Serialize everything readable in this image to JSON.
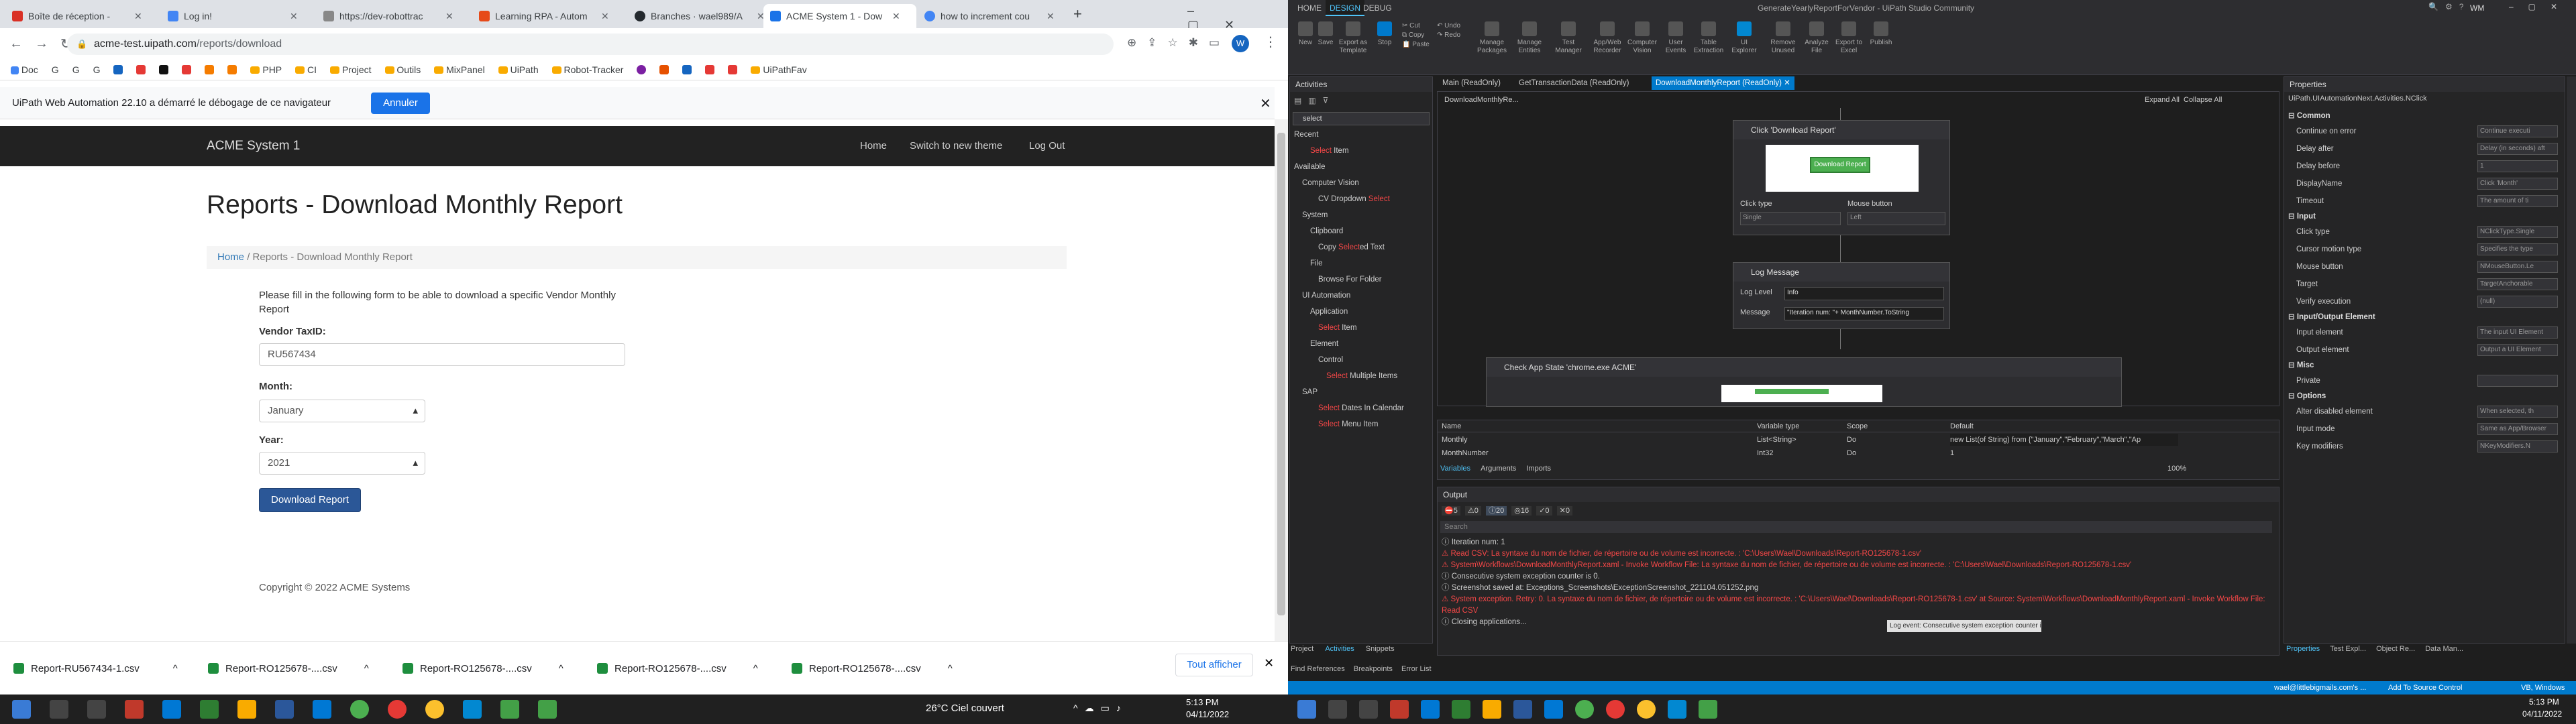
{
  "colors": {
    "accent_blue": "#1a73e8",
    "uipath_status": "#007acc",
    "error_red": "#f44747",
    "site_nav": "#222222",
    "button_blue": "#337ab7"
  },
  "browser": {
    "tabs": [
      {
        "title": "Boîte de réception - "
      },
      {
        "title": "Log in!"
      },
      {
        "title": "https://dev-robottrac"
      },
      {
        "title": "Learning RPA - Autom"
      },
      {
        "title": "Branches · wael989/A"
      },
      {
        "title": "ACME System 1 - Dow"
      },
      {
        "title": "how to increment cou"
      }
    ],
    "url_host": "acme-test.uipath.com",
    "url_path": "/reports/download",
    "bookmarks": [
      "Doc",
      "G",
      "G",
      "G",
      "PHP",
      "CI",
      "Project",
      "Outils",
      "MixPanel",
      "UiPath",
      "Robot-Tracker",
      "UiPathFav"
    ],
    "infobar": {
      "message": "UiPath Web Automation 22.10 a démarré le débogage de ce navigateur",
      "button": "Annuler"
    }
  },
  "site": {
    "brand": "ACME System 1",
    "nav": [
      "Home",
      "Switch to new theme",
      "Log Out"
    ],
    "title": "Reports - Download Monthly Report",
    "breadcrumb": {
      "home": "Home",
      "sep": "/",
      "current": "Reports - Download Monthly Report"
    },
    "intro": "Please fill in the following form to be able to download a specific Vendor Monthly Report",
    "vendor_label": "Vendor TaxID:",
    "vendor_value": "RU567434",
    "month_label": "Month:",
    "month_value": "January",
    "year_label": "Year:",
    "year_value": "2021",
    "button": "Download Report",
    "footer": "Copyright © 2022 ACME Systems"
  },
  "downloads": {
    "items": [
      "Report-RU567434-1.csv",
      "Report-RO125678-....csv",
      "Report-RO125678-....csv",
      "Report-RO125678-....csv",
      "Report-RO125678-....csv"
    ],
    "show_all": "Tout afficher"
  },
  "taskbar": {
    "weather": "26°C  Ciel couvert",
    "time": "5:13 PM",
    "date": "04/11/2022"
  },
  "studio": {
    "title": "GenerateYearlyReportForVendor - UiPath Studio Community",
    "user": "WM",
    "ribbon_tabs": [
      "HOME",
      "DESIGN",
      "DEBUG"
    ],
    "ribbon_buttons": [
      "New",
      "Save",
      "Export as Template",
      "Stop",
      "Cut",
      "Copy",
      "Paste",
      "Undo",
      "Redo",
      "Manage Packages",
      "Manage Entities",
      "Test Manager",
      "App/Web Recorder",
      "Computer Vision",
      "User Events",
      "Table Extraction",
      "UI Explorer",
      "Remove Unused",
      "Analyze File",
      "Export to Excel",
      "Publish"
    ],
    "activities": {
      "header": "Activities",
      "search": "select",
      "tree": [
        {
          "t": "Recent",
          "d": 0
        },
        {
          "t": "Select Item",
          "d": 2,
          "red": "Select"
        },
        {
          "t": "Available",
          "d": 0
        },
        {
          "t": "Computer Vision",
          "d": 1
        },
        {
          "t": "CV Dropdown Select",
          "d": 3
        },
        {
          "t": "System",
          "d": 1
        },
        {
          "t": "Clipboard",
          "d": 2
        },
        {
          "t": "Copy Selected Text",
          "d": 3
        },
        {
          "t": "File",
          "d": 2
        },
        {
          "t": "Browse For Folder",
          "d": 3
        },
        {
          "t": "UI Automation",
          "d": 1
        },
        {
          "t": "Application",
          "d": 2
        },
        {
          "t": "Select Item",
          "d": 3
        },
        {
          "t": "Element",
          "d": 2
        },
        {
          "t": "Control",
          "d": 3
        },
        {
          "t": "Select Multiple Items",
          "d": 4
        },
        {
          "t": "SAP",
          "d": 1
        },
        {
          "t": "Select Dates In Calendar",
          "d": 3
        },
        {
          "t": "Select Menu Item",
          "d": 3
        }
      ],
      "footer_tabs": [
        "Project",
        "Activities",
        "Snippets"
      ],
      "footer_tabs2": [
        "Find References",
        "Breakpoints",
        "Error List"
      ]
    },
    "doc_tabs": [
      "Main (ReadOnly)",
      "GetTransactionData (ReadOnly)",
      "DownloadMonthlyReport (ReadOnly)"
    ],
    "designer": {
      "crumb": "DownloadMonthlyRe...",
      "expand": "Expand All",
      "collapse": "Collapse All",
      "click_title": "Click 'Download Report'",
      "click_button": "Download Report",
      "click_type_label": "Click type",
      "click_type": "Single",
      "mouse_label": "Mouse button",
      "mouse": "Left",
      "log_title": "Log Message",
      "log_level_label": "Log Level",
      "log_level": "Info",
      "message_label": "Message",
      "message": "\"Iteration num: \"+ MonthNumber.ToString",
      "check_title": "Check App State 'chrome.exe ACME'"
    },
    "variables": {
      "headers": [
        "Name",
        "Variable type",
        "Scope",
        "Default"
      ],
      "rows": [
        [
          "Monthly",
          "List<String>",
          "Do",
          "new List(of String) from {\"January\",\"February\",\"March\",\"Ap"
        ],
        [
          "MonthNumber",
          "Int32",
          "Do",
          "1"
        ]
      ],
      "tabs": [
        "Variables",
        "Arguments",
        "Imports"
      ],
      "zoom": "100%"
    },
    "output": {
      "header": "Output",
      "badges": [
        "5",
        "0",
        "20",
        "16",
        "0",
        "0"
      ],
      "search": "Search",
      "lines": [
        {
          "t": "Iteration num: 1",
          "e": false
        },
        {
          "t": "Read CSV: La syntaxe du nom de fichier, de répertoire ou de volume est incorrecte. : 'C:\\Users\\Wael\\Downloads\\Report-RO125678-1.csv'",
          "e": true
        },
        {
          "t": "System\\Workflows\\DownloadMonthlyReport.xaml - Invoke Workflow File: La syntaxe du nom de fichier, de répertoire ou de volume est incorrecte. : 'C:\\Users\\Wael\\Downloads\\Report-RO125678-1.csv'",
          "e": true
        },
        {
          "t": "Consecutive system exception counter is 0.",
          "e": false
        },
        {
          "t": "Screenshot saved at: Exceptions_Screenshots\\ExceptionScreenshot_221104.051252.png",
          "e": false
        },
        {
          "t": "System exception. Retry: 0. La syntaxe du nom de fichier, de répertoire ou de volume est incorrecte. : 'C:\\Users\\Wael\\Downloads\\Report-RO125678-1.csv' at Source: System\\Workflows\\DownloadMonthlyReport.xaml - Invoke Workflow File: Read CSV",
          "e": true
        },
        {
          "t": "Closing applications...",
          "e": false
        }
      ],
      "tooltip": "Log event: Consecutive system exception counter is 0."
    },
    "properties": {
      "header": "Properties",
      "type": "UiPath.UIAutomationNext.Activities.NClick",
      "sections": [
        {
          "name": "Common",
          "rows": [
            [
              "Continue on error",
              "Continue executi"
            ],
            [
              "Delay after",
              "Delay (in seconds) aft"
            ],
            [
              "Delay before",
              "1"
            ],
            [
              "DisplayName",
              "Click 'Month'"
            ],
            [
              "Timeout",
              "The amount of ti"
            ]
          ]
        },
        {
          "name": "Input",
          "rows": [
            [
              "Click type",
              "NClickType.Single"
            ],
            [
              "Cursor motion type",
              "Specifies the type"
            ],
            [
              "Mouse button",
              "NMouseButton.Le"
            ],
            [
              "Target",
              "TargetAnchorable"
            ],
            [
              "Verify execution",
              "(null)"
            ]
          ]
        },
        {
          "name": "Input/Output Element",
          "rows": [
            [
              "Input element",
              "The input UI Element"
            ],
            [
              "Output element",
              "Output a UI Element"
            ]
          ]
        },
        {
          "name": "Misc",
          "rows": [
            [
              "Private",
              ""
            ]
          ]
        },
        {
          "name": "Options",
          "rows": [
            [
              "Alter disabled element",
              "When selected, th"
            ],
            [
              "Input mode",
              "Same as App/Browser"
            ],
            [
              "Key modifiers",
              "NKeyModifiers.N"
            ]
          ]
        }
      ],
      "footer_tabs": [
        "Properties",
        "Test Expl...",
        "Object Re...",
        "Data Man..."
      ]
    },
    "statusbar": {
      "email": "wael@littlebigmails.com's ...",
      "source": "Add To Source Control",
      "env": "VB, Windows"
    }
  }
}
